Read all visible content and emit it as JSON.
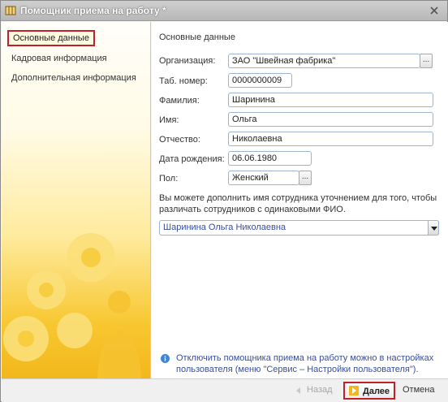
{
  "window": {
    "title": "Помощник приема на работу *"
  },
  "sidebar": {
    "items": [
      {
        "label": "Основные данные",
        "active": true
      },
      {
        "label": "Кадровая информация"
      },
      {
        "label": "Дополнительная информация"
      }
    ]
  },
  "main": {
    "section_title": "Основные данные",
    "organization": {
      "label": "Организация:",
      "value": "ЗАО \"Швейная фабрика\""
    },
    "tab_number": {
      "label": "Таб. номер:",
      "value": "0000000009"
    },
    "last_name": {
      "label": "Фамилия:",
      "value": "Шаринина"
    },
    "first_name": {
      "label": "Имя:",
      "value": "Ольга"
    },
    "middle_name": {
      "label": "Отчество:",
      "value": "Николаевна"
    },
    "birth_date": {
      "label": "Дата рождения:",
      "value": "06.06.1980"
    },
    "gender": {
      "label": "Пол:",
      "value": "Женский"
    },
    "select_button": "...",
    "note": "Вы можете дополнить имя сотрудника уточнением для того, чтобы различать сотрудников с одинаковыми ФИО.",
    "full_name_combo": "Шаринина Ольга Николаевна",
    "info_text": "Отключить помощника приема на работу можно в настройках пользователя (меню \"Сервис – Настройки пользователя\")."
  },
  "footer": {
    "back": "Назад",
    "next": "Далее",
    "cancel": "Отмена"
  },
  "colors": {
    "accent_highlight": "#c0202a",
    "sidebar_gradient_end": "#f2b71c",
    "link_blue": "#3a4f9a"
  },
  "icons": {
    "title": "table-icon",
    "close": "close-icon",
    "info": "info-icon",
    "back": "arrow-left-icon",
    "next": "arrow-right-icon"
  }
}
